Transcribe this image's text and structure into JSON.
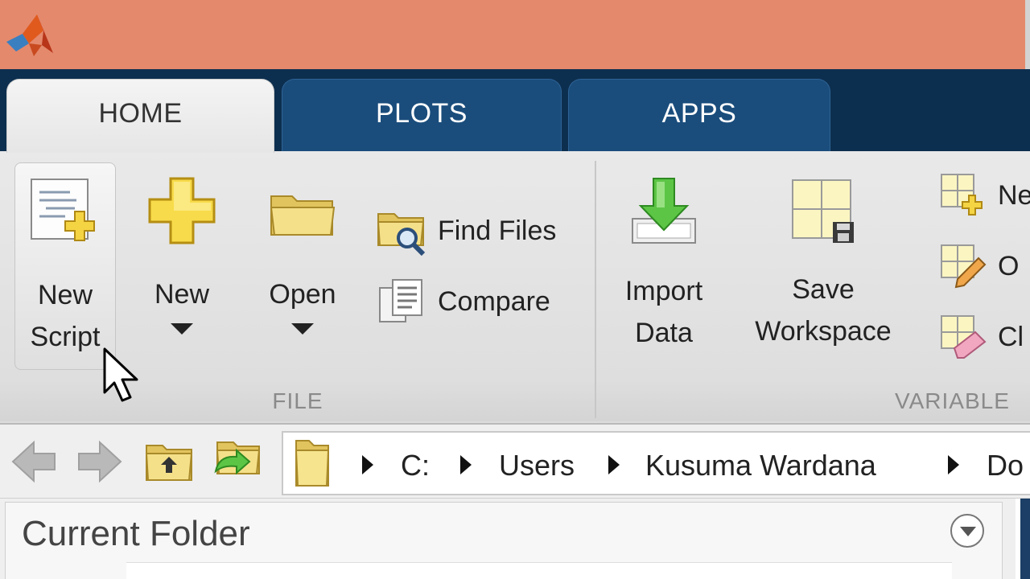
{
  "tabs": [
    {
      "label": "HOME",
      "active": true
    },
    {
      "label": "PLOTS",
      "active": false
    },
    {
      "label": "APPS",
      "active": false
    }
  ],
  "file_group": {
    "footer": "FILE",
    "new_script": {
      "line1": "New",
      "line2": "Script",
      "icon": "new-script-icon"
    },
    "new": {
      "label": "New",
      "icon": "plus-icon"
    },
    "open": {
      "label": "Open",
      "icon": "folder-icon"
    },
    "find_files": {
      "label": "Find Files",
      "icon": "find-files-icon"
    },
    "compare": {
      "label": "Compare",
      "icon": "compare-icon"
    }
  },
  "variable_group": {
    "footer": "VARIABLE",
    "import_data": {
      "line1": "Import",
      "line2": "Data",
      "icon": "import-data-icon"
    },
    "save_workspace": {
      "line1": "Save",
      "line2": "Workspace",
      "icon": "save-workspace-icon"
    },
    "new_variable": {
      "label": "Ne",
      "icon": "new-variable-icon"
    },
    "open_variable": {
      "label": "O",
      "icon": "open-variable-icon"
    },
    "clear_workspace": {
      "label": "Cl",
      "icon": "clear-workspace-icon"
    }
  },
  "address_bar": {
    "crumbs": [
      "C:",
      "Users",
      "Kusuma Wardana",
      "Do"
    ]
  },
  "current_folder": {
    "title": "Current Folder"
  },
  "colors": {
    "titlebar": "#e4896c",
    "tabstrip": "#0d2f4f",
    "tab_inactive": "#1a4d7c"
  }
}
